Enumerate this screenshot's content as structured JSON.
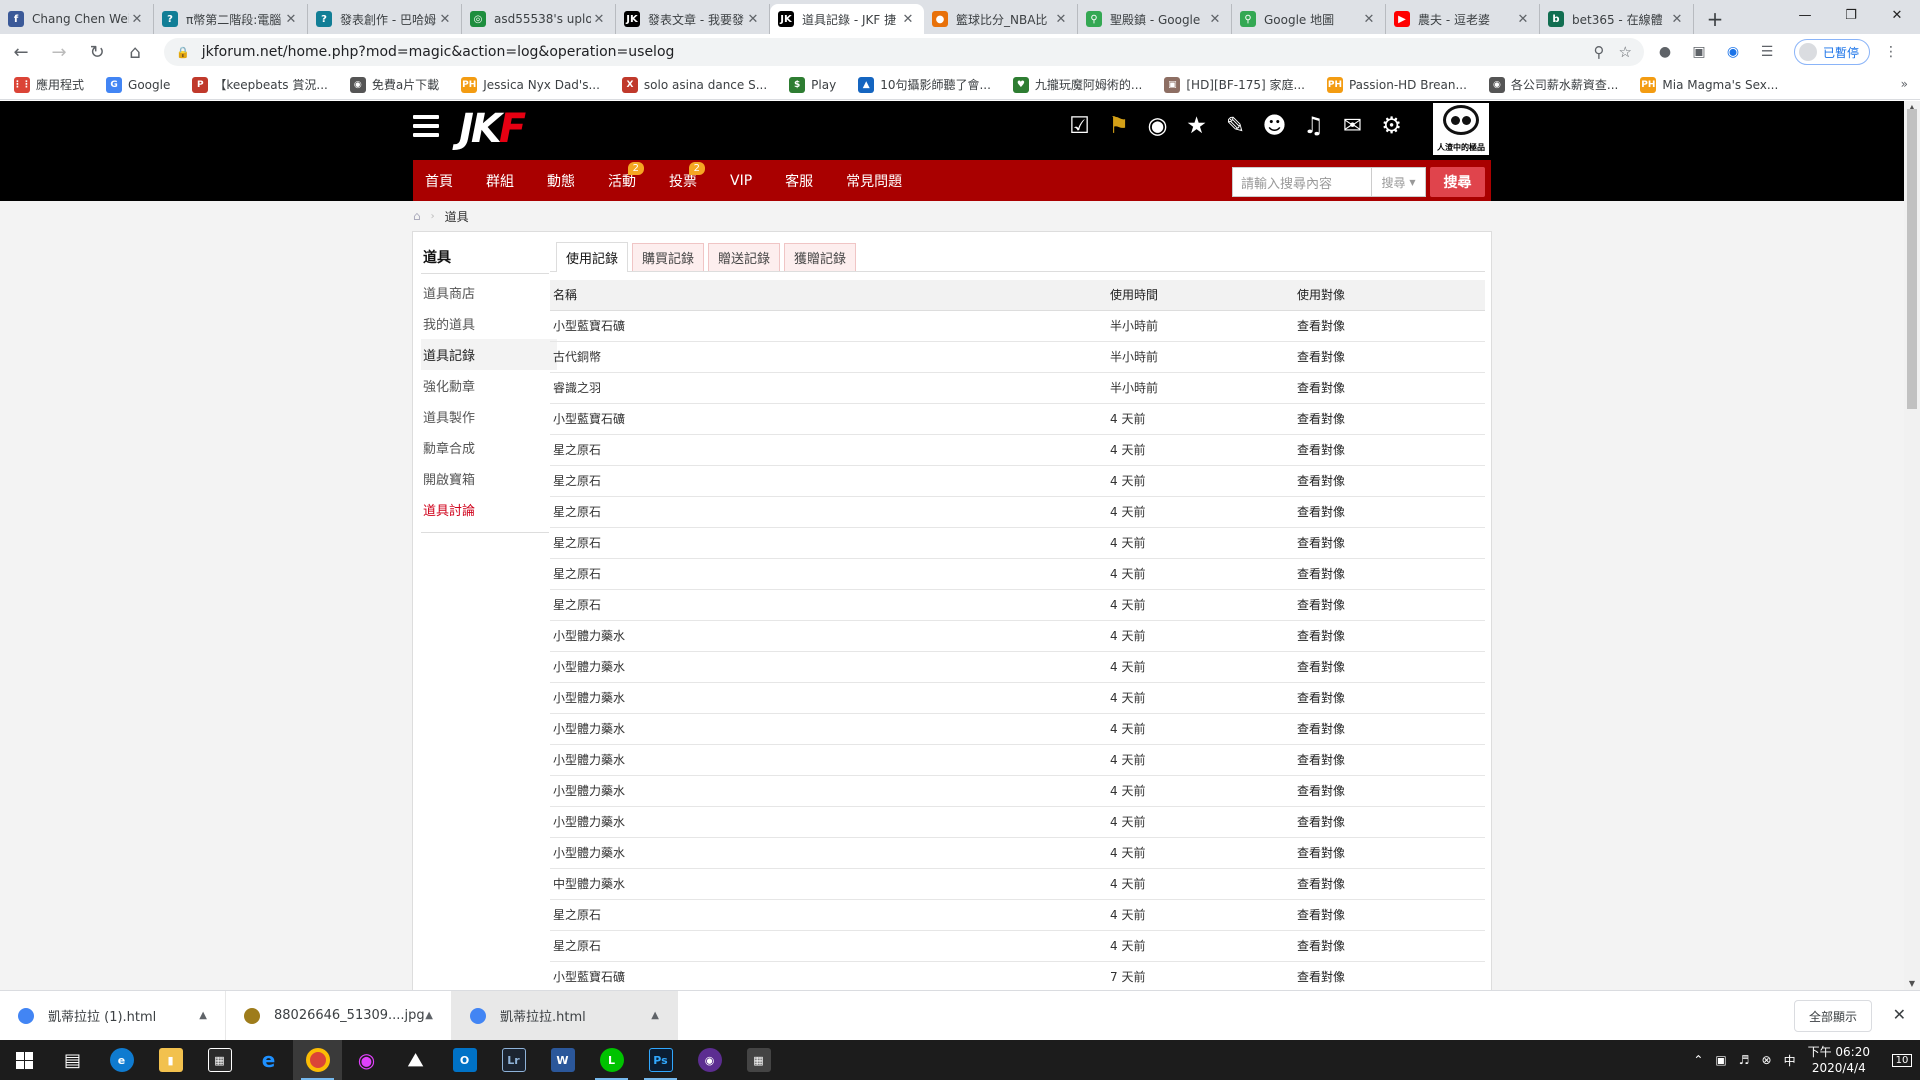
{
  "browser": {
    "tabs": [
      {
        "title": "Chang Chen Wei",
        "icon": "facebook-icon",
        "color": "#3b5998",
        "glyph": "f",
        "active": false
      },
      {
        "title": "π幣第二階段:電腦",
        "icon": "bahamut-icon",
        "color": "#117e96",
        "glyph": "?",
        "active": false
      },
      {
        "title": "發表創作 - 巴哈姆",
        "icon": "bahamut-icon",
        "color": "#117e96",
        "glyph": "?",
        "active": false
      },
      {
        "title": "asd55538's uplo",
        "icon": "upload-icon",
        "color": "#1e8e3e",
        "glyph": "◎",
        "active": false
      },
      {
        "title": "發表文章 - 我要發",
        "icon": "jkf-icon",
        "color": "#000000",
        "glyph": "JK",
        "active": false
      },
      {
        "title": "道具記錄 - JKF 捷",
        "icon": "jkf-icon",
        "color": "#000000",
        "glyph": "JK",
        "active": true
      },
      {
        "title": "籃球比分_NBA比",
        "icon": "basketball-icon",
        "color": "#e8710a",
        "glyph": "●",
        "active": false
      },
      {
        "title": "聖殿鎮 - Google",
        "icon": "maps-icon",
        "color": "#34a853",
        "glyph": "⚲",
        "active": false
      },
      {
        "title": "Google 地圖",
        "icon": "maps-icon",
        "color": "#34a853",
        "glyph": "⚲",
        "active": false
      },
      {
        "title": "農夫 - 逗老婆",
        "icon": "youtube-icon",
        "color": "#ff0000",
        "glyph": "▶",
        "active": false
      },
      {
        "title": "bet365 - 在線體",
        "icon": "bet365-icon",
        "color": "#126e51",
        "glyph": "b",
        "active": false
      }
    ],
    "url": "jkforum.net/home.php?mod=magic&action=log&operation=uselog",
    "profile_label": "已暫停",
    "bookmarks": [
      {
        "label": "應用程式",
        "color": "#db4437",
        "glyph": "⋮⋮"
      },
      {
        "label": "Google",
        "color": "#4285f4",
        "glyph": "G"
      },
      {
        "label": "【keepbeats 賞況...",
        "color": "#c0392b",
        "glyph": "P"
      },
      {
        "label": "免費a片下載",
        "color": "#555555",
        "glyph": "◉"
      },
      {
        "label": "Jessica Nyx Dad's...",
        "color": "#f39c12",
        "glyph": "PH"
      },
      {
        "label": "solo asina dance S...",
        "color": "#c0392b",
        "glyph": "X"
      },
      {
        "label": "Play",
        "color": "#2e7d32",
        "glyph": "$"
      },
      {
        "label": "10句攝影師聽了會...",
        "color": "#1565c0",
        "glyph": "▲"
      },
      {
        "label": "九攏玩魔阿姆術的...",
        "color": "#2e7d32",
        "glyph": "♥"
      },
      {
        "label": "[HD][BF-175] 家庭...",
        "color": "#8d6e63",
        "glyph": "▣"
      },
      {
        "label": "Passion-HD Brean...",
        "color": "#f39c12",
        "glyph": "PH"
      },
      {
        "label": "各公司薪水薪資查...",
        "color": "#555555",
        "glyph": "◉"
      },
      {
        "label": "Mia Magma's Sex...",
        "color": "#f39c12",
        "glyph": "PH"
      }
    ]
  },
  "site": {
    "logo_main": "JK",
    "logo_accent": "F",
    "avatar_caption": "人渣中的極品",
    "nav": [
      {
        "label": "首頁",
        "badge": ""
      },
      {
        "label": "群組",
        "badge": ""
      },
      {
        "label": "動態",
        "badge": ""
      },
      {
        "label": "活動",
        "badge": "2"
      },
      {
        "label": "投票",
        "badge": "2"
      },
      {
        "label": "VIP",
        "badge": ""
      },
      {
        "label": "客服",
        "badge": ""
      },
      {
        "label": "常見問題",
        "badge": ""
      }
    ],
    "search_placeholder": "請輸入搜尋內容",
    "search_scope": "搜尋",
    "search_button": "搜尋",
    "colors": {
      "nav_red": "#a90000",
      "search_btn": "#e0444c",
      "badge": "#f5a623"
    }
  },
  "breadcrumb": {
    "current": "道具"
  },
  "sidebar": {
    "title": "道具",
    "items": [
      {
        "label": "道具商店",
        "state": "normal"
      },
      {
        "label": "我的道具",
        "state": "normal"
      },
      {
        "label": "道具記錄",
        "state": "active"
      },
      {
        "label": "強化勳章",
        "state": "normal"
      },
      {
        "label": "道具製作",
        "state": "normal"
      },
      {
        "label": "勳章合成",
        "state": "normal"
      },
      {
        "label": "開啟寶箱",
        "state": "normal"
      },
      {
        "label": "道具討論",
        "state": "red"
      }
    ]
  },
  "log": {
    "tabs": [
      {
        "label": "使用記錄",
        "active": true
      },
      {
        "label": "購買記錄",
        "active": false
      },
      {
        "label": "贈送記錄",
        "active": false
      },
      {
        "label": "獲贈記錄",
        "active": false
      }
    ],
    "columns": [
      "名稱",
      "使用時間",
      "使用對像"
    ],
    "rows": [
      [
        "小型藍寶石礦",
        "半小時前",
        "查看對像"
      ],
      [
        "古代銅幣",
        "半小時前",
        "查看對像"
      ],
      [
        "睿識之羽",
        "半小時前",
        "查看對像"
      ],
      [
        "小型藍寶石礦",
        "4 天前",
        "查看對像"
      ],
      [
        "星之原石",
        "4 天前",
        "查看對像"
      ],
      [
        "星之原石",
        "4 天前",
        "查看對像"
      ],
      [
        "星之原石",
        "4 天前",
        "查看對像"
      ],
      [
        "星之原石",
        "4 天前",
        "查看對像"
      ],
      [
        "星之原石",
        "4 天前",
        "查看對像"
      ],
      [
        "星之原石",
        "4 天前",
        "查看對像"
      ],
      [
        "小型體力藥水",
        "4 天前",
        "查看對像"
      ],
      [
        "小型體力藥水",
        "4 天前",
        "查看對像"
      ],
      [
        "小型體力藥水",
        "4 天前",
        "查看對像"
      ],
      [
        "小型體力藥水",
        "4 天前",
        "查看對像"
      ],
      [
        "小型體力藥水",
        "4 天前",
        "查看對像"
      ],
      [
        "小型體力藥水",
        "4 天前",
        "查看對像"
      ],
      [
        "小型體力藥水",
        "4 天前",
        "查看對像"
      ],
      [
        "小型體力藥水",
        "4 天前",
        "查看對像"
      ],
      [
        "中型體力藥水",
        "4 天前",
        "查看對像"
      ],
      [
        "星之原石",
        "4 天前",
        "查看對像"
      ],
      [
        "星之原石",
        "4 天前",
        "查看對像"
      ],
      [
        "小型藍寶石礦",
        "7 天前",
        "查看對像"
      ]
    ]
  },
  "downloads": {
    "items": [
      {
        "name": "凱蒂拉拉 (1).html",
        "color": "#4285f4"
      },
      {
        "name": "88026646_51309....jpg",
        "color": "#9e7c1b"
      },
      {
        "name": "凱蒂拉拉.html",
        "color": "#4285f4"
      }
    ],
    "show_all": "全部顯示"
  },
  "taskbar": {
    "time": "下午 06:20",
    "date": "2020/4/4",
    "notifications": "10"
  }
}
